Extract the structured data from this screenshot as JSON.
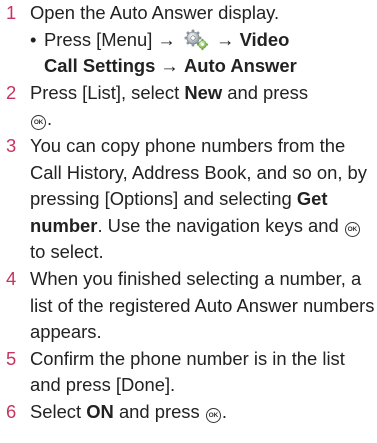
{
  "steps": [
    {
      "num": "1",
      "text": "Open the Auto Answer display."
    },
    {
      "num": "2",
      "part1": "Press [List], select ",
      "bold": "New",
      "part2": " and press",
      "ok": "OK",
      "part3": "."
    },
    {
      "num": "3",
      "part1": "You can copy phone numbers from the Call History, Address Book, and so on, by pressing [Options] and selecting ",
      "bold": "Get number",
      "part2": ". Use the navigation keys and ",
      "ok": "OK",
      "part3": " to select."
    },
    {
      "num": "4",
      "text": "When you finished selecting a number, a list of the registered Auto Answer numbers appears."
    },
    {
      "num": "5",
      "text": "Confirm the phone number is in the list and press [Done]."
    },
    {
      "num": "6",
      "part1": "Select ",
      "bold": "ON",
      "part2": " and press ",
      "ok": "OK",
      "part3": "."
    }
  ],
  "bullet": {
    "dot": "•",
    "part1": "Press [Menu] → ",
    "icon": "settings-gear-icon",
    "arrow": " → ",
    "bold1": "Video",
    "bold2": "Call Settings",
    "arrow2": " → ",
    "bold3": "Auto Answer"
  }
}
